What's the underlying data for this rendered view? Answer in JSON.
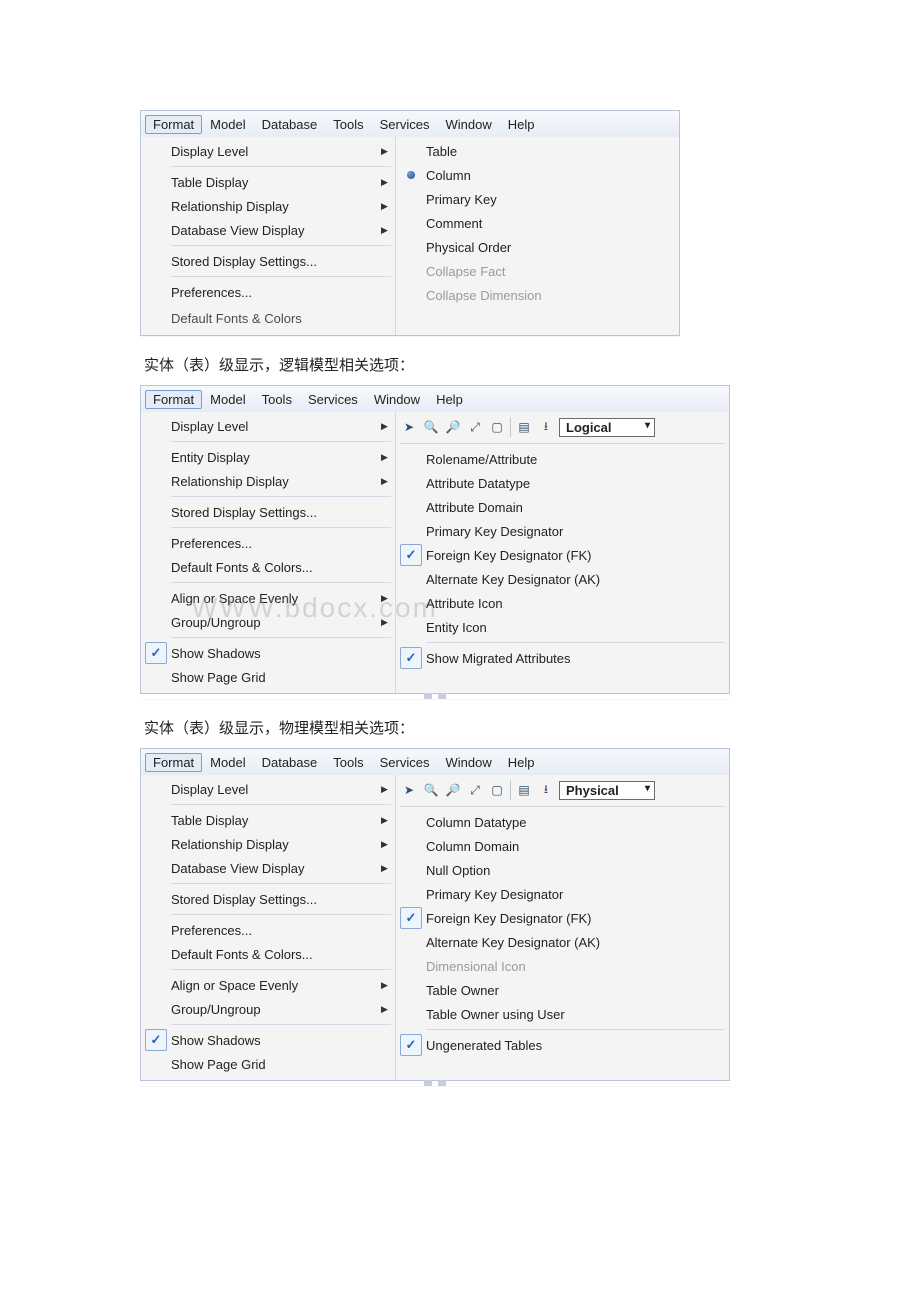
{
  "shot1": {
    "menubar": [
      "Format",
      "Model",
      "Database",
      "Tools",
      "Services",
      "Window",
      "Help"
    ],
    "dropdown": {
      "displayLevel": "Display Level",
      "tableDisplay": "Table Display",
      "relationshipDisplay": "Relationship Display",
      "databaseViewDisplay": "Database View Display",
      "storedDisplaySettings": "Stored Display Settings...",
      "preferences": "Preferences...",
      "defaultFontsColors": "Default Fonts & Colors"
    },
    "submenu": {
      "table": "Table",
      "column": "Column",
      "primaryKey": "Primary Key",
      "comment": "Comment",
      "physicalOrder": "Physical Order",
      "collapseFact": "Collapse Fact",
      "collapseDimension": "Collapse Dimension"
    }
  },
  "caption1": "实体（表）级显示，逻辑模型相关选项：",
  "shot2": {
    "menubar": [
      "Format",
      "Model",
      "Tools",
      "Services",
      "Window",
      "Help"
    ],
    "combo": "Logical",
    "dropdown": {
      "displayLevel": "Display Level",
      "entityDisplay": "Entity Display",
      "relationshipDisplay": "Relationship Display",
      "storedDisplaySettings": "Stored Display Settings...",
      "preferences": "Preferences...",
      "defaultFontsColors": "Default Fonts & Colors...",
      "alignOrSpaceEvenly": "Align or Space Evenly",
      "groupUngroup": "Group/Ungroup",
      "showShadows": "Show Shadows",
      "showPageGrid": "Show Page Grid"
    },
    "submenu": {
      "rolenameAttribute": "Rolename/Attribute",
      "attributeDatatype": "Attribute Datatype",
      "attributeDomain": "Attribute Domain",
      "primaryKeyDesignator": "Primary Key Designator",
      "foreignKeyDesignator": "Foreign Key Designator (FK)",
      "alternateKeyDesignator": "Alternate Key Designator (AK)",
      "attributeIcon": "Attribute Icon",
      "entityIcon": "Entity Icon",
      "showMigratedAttributes": "Show Migrated Attributes"
    }
  },
  "caption2": "实体（表）级显示，物理模型相关选项：",
  "shot3": {
    "menubar": [
      "Format",
      "Model",
      "Database",
      "Tools",
      "Services",
      "Window",
      "Help"
    ],
    "combo": "Physical",
    "dropdown": {
      "displayLevel": "Display Level",
      "tableDisplay": "Table Display",
      "relationshipDisplay": "Relationship Display",
      "databaseViewDisplay": "Database View Display",
      "storedDisplaySettings": "Stored Display Settings...",
      "preferences": "Preferences...",
      "defaultFontsColors": "Default Fonts & Colors...",
      "alignOrSpaceEvenly": "Align or Space Evenly",
      "groupUngroup": "Group/Ungroup",
      "showShadows": "Show Shadows",
      "showPageGrid": "Show Page Grid"
    },
    "submenu": {
      "columnDatatype": "Column Datatype",
      "columnDomain": "Column Domain",
      "nullOption": "Null Option",
      "primaryKeyDesignator": "Primary Key Designator",
      "foreignKeyDesignator": "Foreign Key Designator (FK)",
      "alternateKeyDesignator": "Alternate Key Designator (AK)",
      "dimensionalIcon": "Dimensional Icon",
      "tableOwner": "Table Owner",
      "tableOwnerUsingUser": "Table Owner using User",
      "ungeneratedTables": "Ungenerated Tables"
    }
  }
}
